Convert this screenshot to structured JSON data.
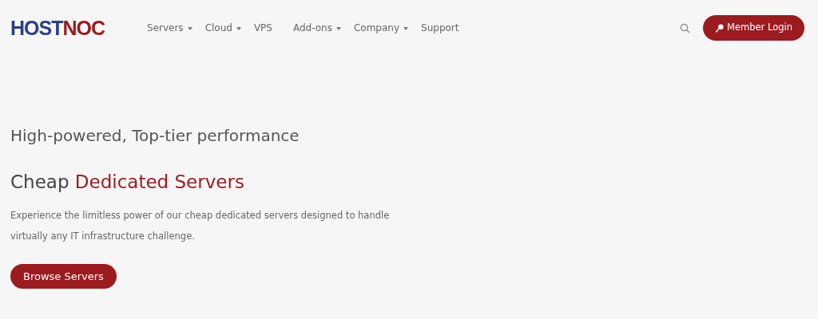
{
  "logo": {
    "parts": [
      {
        "text": "HOST",
        "color": "#2b3f85"
      },
      {
        "text": "NOC",
        "color": "#9b1b1f"
      }
    ]
  },
  "nav": [
    {
      "label": "Servers",
      "dropdown": true
    },
    {
      "label": "Cloud",
      "dropdown": true
    },
    {
      "label": "VPS",
      "dropdown": false
    },
    {
      "label": "Add-ons",
      "dropdown": true
    },
    {
      "label": "Company",
      "dropdown": true
    },
    {
      "label": "Support",
      "dropdown": false
    }
  ],
  "login_button": {
    "label": "Member Login"
  },
  "hero": {
    "subtitle": "High-powered, Top-tier performance",
    "title_plain": "Cheap",
    "title_accent": "Dedicated Servers",
    "description": "Experience the limitless power of our cheap dedicated servers designed to handle virtually any IT infrastructure challenge.",
    "button": "Browse Servers"
  }
}
